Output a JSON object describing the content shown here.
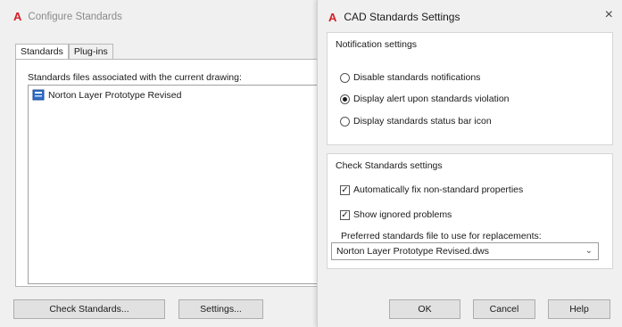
{
  "configure_dialog": {
    "title": "Configure Standards",
    "tabs": [
      {
        "label": "Standards",
        "active": true
      },
      {
        "label": "Plug-ins",
        "active": false
      }
    ],
    "list_label": "Standards files associated with the current drawing:",
    "files": [
      {
        "name": "Norton Layer Prototype Revised",
        "icon": "dws-file-icon"
      }
    ],
    "check_standards_label": "Check Standards...",
    "settings_label": "Settings..."
  },
  "settings_dialog": {
    "title": "CAD Standards Settings",
    "close_glyph": "×",
    "notification_group": {
      "title": "Notification settings",
      "options": [
        {
          "label": "Disable standards notifications",
          "selected": false
        },
        {
          "label": "Display alert upon standards violation",
          "selected": true
        },
        {
          "label": "Display standards status bar icon",
          "selected": false
        }
      ]
    },
    "check_group": {
      "title": "Check Standards settings",
      "checkboxes": [
        {
          "label": "Automatically fix non-standard properties",
          "checked": true
        },
        {
          "label": "Show ignored problems",
          "checked": true
        }
      ],
      "preferred_label": "Preferred standards file to use for replacements:",
      "preferred_value": "Norton Layer Prototype Revised.dws"
    },
    "ok_label": "OK",
    "cancel_label": "Cancel",
    "help_label": "Help"
  },
  "colors": {
    "autocad_red": "#d11f26",
    "dialog_bg": "#f0f0f0",
    "button_bg": "#e1e1e1"
  }
}
